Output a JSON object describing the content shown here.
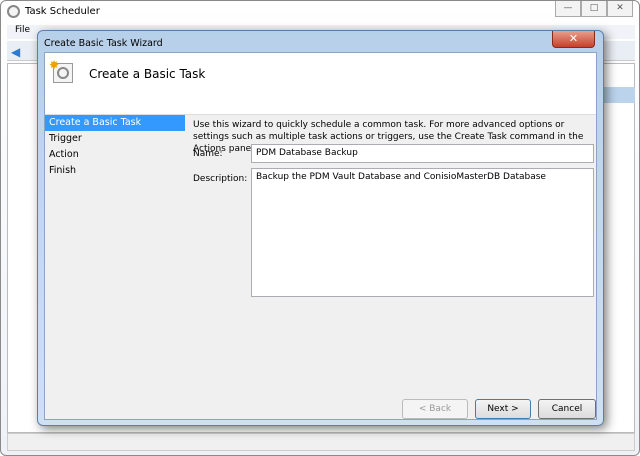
{
  "window": {
    "title": "Task Scheduler",
    "menu": [
      "File"
    ],
    "controls": [
      "—",
      "□",
      "✕"
    ]
  },
  "dialog": {
    "title": "Create Basic Task Wizard",
    "close": "✕",
    "header": "Create a Basic Task",
    "steps": [
      "Create a Basic Task",
      "Trigger",
      "Action",
      "Finish"
    ],
    "intro": "Use this wizard to quickly schedule a common task.  For more advanced options or settings such as multiple task actions or triggers, use the Create Task command in the Actions pane.",
    "name_label": "Name:",
    "name_value": "PDM Database Backup",
    "description_label": "Description:",
    "description_value": "Backup the PDM Vault Database and ConisioMasterDB Database",
    "buttons": {
      "back": "< Back",
      "next": "Next >",
      "cancel": "Cancel"
    }
  }
}
